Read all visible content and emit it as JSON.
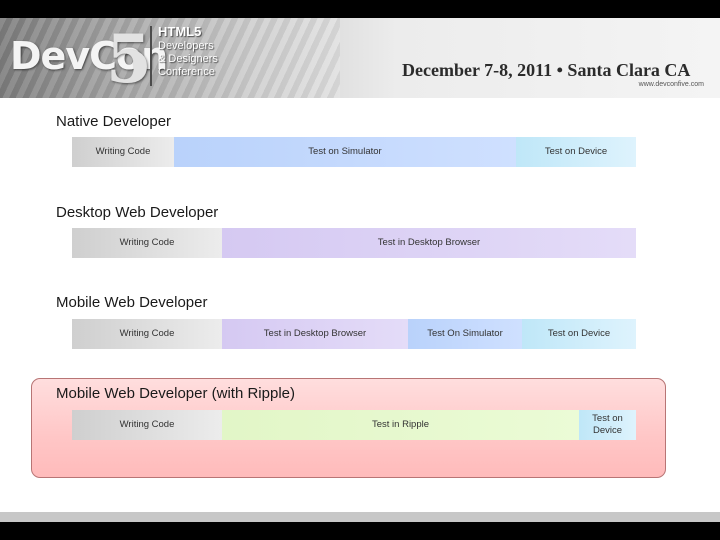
{
  "header": {
    "logo_text": "DevCon",
    "logo_number": "5",
    "logo_html5": "HTML5",
    "logo_subtitle_1": "Developers",
    "logo_subtitle_2": "& Designers",
    "logo_subtitle_3": "Conference",
    "event_info": "December 7-8, 2011 • Santa Clara CA",
    "url": "www.devconfive.com"
  },
  "sections": [
    {
      "title": "Native Developer",
      "segments": [
        "Writing Code",
        "Test on Simulator",
        "Test on Device"
      ]
    },
    {
      "title": "Desktop Web Developer",
      "segments": [
        "Writing Code",
        "Test in Desktop Browser"
      ]
    },
    {
      "title": "Mobile Web Developer",
      "segments": [
        "Writing Code",
        "Test in Desktop Browser",
        "Test On Simulator",
        "Test on Device"
      ]
    },
    {
      "title": "Mobile Web Developer (with Ripple)",
      "segments": [
        "Writing Code",
        "Test in Ripple",
        "Test on Device"
      ]
    }
  ]
}
